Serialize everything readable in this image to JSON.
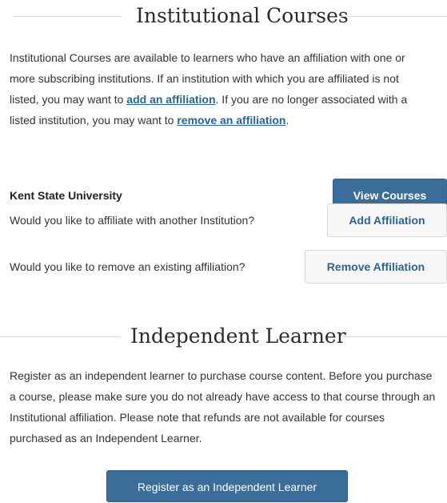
{
  "institutional": {
    "heading": "Institutional Courses",
    "paragraph": {
      "line1": "Institutional Courses are available to learners who have an affiliation with one or",
      "line2": "more subscribing institutions. If an institution with which you are affiliated is not",
      "line3_before": "listed, you may want to ",
      "line3_link": "add an affiliation",
      "line3_after": ". If you are no longer associated with a",
      "line4_before": "listed institution, you may want to ",
      "line4_link": "remove an affiliation",
      "line4_after": "."
    },
    "institution_name": "Kent State University",
    "view_courses_label": "View Courses",
    "add_question": "Would you like to affiliate with another Institution?",
    "add_affiliation_label": "Add Affiliation",
    "remove_question": "Would you like to remove an existing affiliation?",
    "remove_affiliation_label": "Remove Affiliation"
  },
  "independent": {
    "heading": "Independent Learner",
    "paragraph": {
      "line1": "Register as an independent learner to purchase course content. Before you purchase",
      "line2": "a course, please make sure you do not already have access to that course through an",
      "line3": "Institutional affiliation. Please note that refunds are not available for courses",
      "line4": "purchased as an Independent Learner."
    },
    "register_label": "Register as an Independent Learner"
  },
  "colors": {
    "primary_button": "#3a6d99",
    "link": "#2a6496",
    "default_button_bg": "#f7f7f7"
  }
}
